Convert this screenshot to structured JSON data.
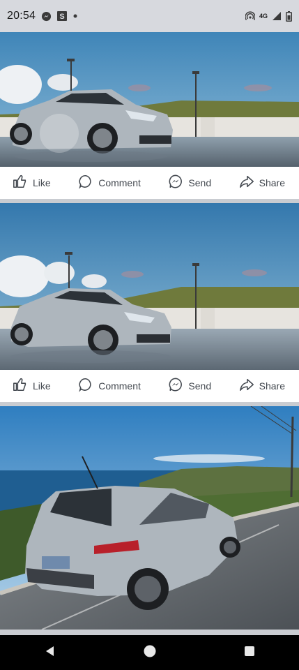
{
  "status_bar": {
    "time": "20:54",
    "left_icons": [
      "messenger-icon",
      "s-app-icon",
      "dot-icon"
    ],
    "right_icons": [
      "hotspot-icon",
      "4g-icon",
      "signal-icon",
      "battery-icon"
    ],
    "network_label": "4G"
  },
  "posts": [
    {
      "photo": "silver-hatchback-on-rooftop-with-watermark",
      "actions": {
        "like": "Like",
        "comment": "Comment",
        "send": "Send",
        "share": "Share"
      }
    },
    {
      "photo": "silver-hatchback-on-rooftop",
      "actions": {
        "like": "Like",
        "comment": "Comment",
        "send": "Send",
        "share": "Share"
      }
    },
    {
      "photo": "silver-hatchback-rear-coastal-road"
    }
  ],
  "nav_bar": {
    "buttons": [
      "back-icon",
      "home-icon",
      "recents-icon"
    ]
  },
  "colors": {
    "action_text": "#444950",
    "status_bar_bg": "#d7d9de",
    "separator": "#c9ccd1",
    "sky_top": "#3f85b8",
    "car_silver": "#aeb6bd"
  }
}
